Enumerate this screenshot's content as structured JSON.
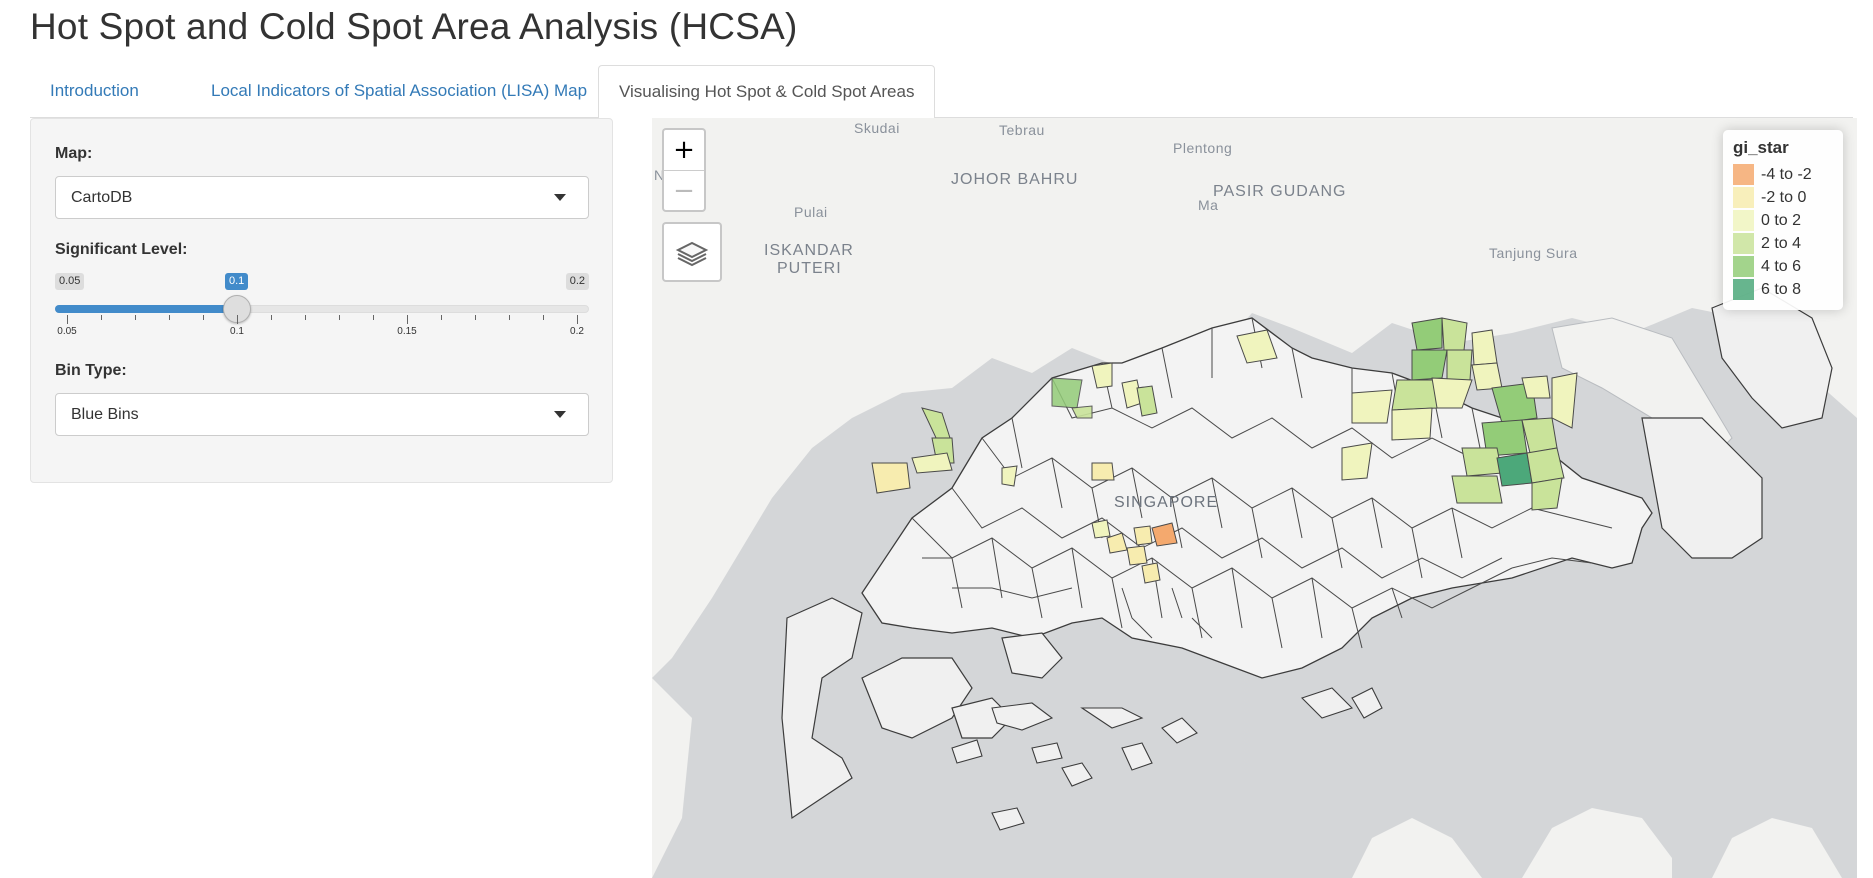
{
  "page": {
    "title": "Hot Spot and Cold Spot Area Analysis (HCSA)"
  },
  "tabs": [
    {
      "label": "Introduction",
      "active": false
    },
    {
      "label": "Local Indicators of Spatial Association (LISA) Map",
      "active": false
    },
    {
      "label": "Visualising Hot Spot & Cold Spot Areas",
      "active": true
    }
  ],
  "sidebar": {
    "map_label": "Map:",
    "map_value": "CartoDB",
    "sig_label": "Significant Level:",
    "slider": {
      "min": 0.05,
      "max": 0.2,
      "value": 0.1,
      "min_text": "0.05",
      "max_text": "0.2",
      "value_text": "0.1",
      "tick_labels": [
        "0.05",
        "0.1",
        "0.15",
        "0.2"
      ]
    },
    "bin_label": "Bin Type:",
    "bin_value": "Blue Bins"
  },
  "map": {
    "zoom_in": "+",
    "zoom_out": "−",
    "legend": {
      "title": "gi_star",
      "items": [
        {
          "label": "-4 to -2",
          "color": "#f4a96e"
        },
        {
          "label": "-2 to 0",
          "color": "#f7ecaf"
        },
        {
          "label": "0 to 2",
          "color": "#f0f4be"
        },
        {
          "label": "2 to 4",
          "color": "#c9e39a"
        },
        {
          "label": "4 to 6",
          "color": "#93cc78"
        },
        {
          "label": "6 to 8",
          "color": "#4ca87a"
        }
      ]
    },
    "labels": {
      "skudai": "Skudai",
      "tebrau": "Tebrau",
      "plentong": "Plentong",
      "johor_bahru": "JOHOR BAHRU",
      "pasir_gudang": "PASIR GUDANG",
      "ma": "Ma",
      "pulai": "Pulai",
      "iskandar": "ISKANDAR",
      "puteri": "PUTERI",
      "tanjung_surat": "Tanjung Sura",
      "nanas": "Nanas",
      "singapore": "SINGAPORE"
    }
  }
}
